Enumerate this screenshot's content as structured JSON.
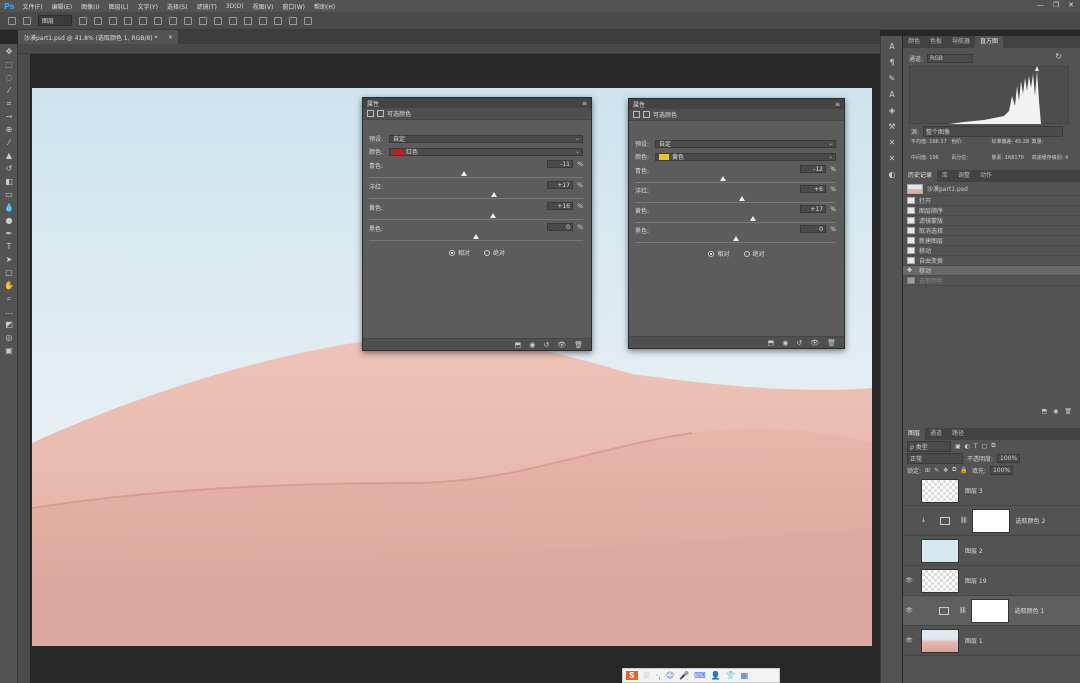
{
  "menubar": {
    "logo": "Ps",
    "items": [
      "文件(F)",
      "编辑(E)",
      "图像(I)",
      "图层(L)",
      "文字(Y)",
      "选择(S)",
      "滤镜(T)",
      "3D(D)",
      "视图(V)",
      "窗口(W)",
      "帮助(H)"
    ],
    "window_controls": [
      "—",
      "❐",
      "✕"
    ]
  },
  "optionsbar": {
    "auto_select_value": "图层"
  },
  "document": {
    "tab_title": "沙漠part1.psd @ 41.8% (选取颜色 1, RGB/8) *",
    "tab_close": "×"
  },
  "props_left": {
    "title": "属性",
    "header": "可选颜色",
    "preset_label": "预设:",
    "preset_value": "自定",
    "colors_label": "颜色:",
    "colors_value": "红色",
    "colors_swatch": "#d01818",
    "sliders": [
      {
        "name": "青色:",
        "value": "-11",
        "pct": "%",
        "level": 0.445
      },
      {
        "name": "洋红:",
        "value": "+17",
        "pct": "%",
        "level": 0.585
      },
      {
        "name": "黄色:",
        "value": "+16",
        "pct": "%",
        "level": 0.58
      },
      {
        "name": "黑色:",
        "value": "0",
        "pct": "%",
        "level": 0.5
      }
    ],
    "radio_relative": "相对",
    "radio_absolute": "绝对"
  },
  "props_right": {
    "title": "属性",
    "header": "可选颜色",
    "preset_label": "预设:",
    "preset_value": "自定",
    "colors_label": "颜色:",
    "colors_value": "黄色",
    "colors_swatch": "#e8c818",
    "sliders": [
      {
        "name": "青色:",
        "value": "-12",
        "pct": "%",
        "level": 0.44
      },
      {
        "name": "洋红:",
        "value": "+6",
        "pct": "%",
        "level": 0.53
      },
      {
        "name": "黄色:",
        "value": "+17",
        "pct": "%",
        "level": 0.585
      },
      {
        "name": "黑色:",
        "value": "0",
        "pct": "%",
        "level": 0.5
      }
    ],
    "radio_relative": "相对",
    "radio_absolute": "绝对"
  },
  "histogram_panel": {
    "tabs": [
      "颜色",
      "色板",
      "导航器",
      "直方图"
    ],
    "active_tab": "直方图",
    "channel_label": "通道:",
    "channel_value": "RGB",
    "source_label": "源:",
    "source_value": "整个图像",
    "stats": [
      "平均值: 186.37",
      "色阶:",
      "标准偏差: 45.28",
      "数量:",
      "中间值: 196",
      "百分位:",
      "像素: 168170",
      "高速缓存级别: 4"
    ]
  },
  "history_panel": {
    "tabs": [
      "历史记录",
      "库",
      "调整",
      "动作"
    ],
    "snapshot": "沙漠part1.psd",
    "items": [
      "打开",
      "图层顺序",
      "滤镜蒙版",
      "取消选择",
      "新建图层",
      "移动",
      "自由变换",
      "移动",
      "选取颜色"
    ],
    "selected_index": 7,
    "dim_index": 8
  },
  "layers_panel": {
    "tabs": [
      "图层",
      "通道",
      "路径"
    ],
    "kind_label": "ρ 类型",
    "blend_mode": "正常",
    "opacity_label": "不透明度:",
    "opacity_value": "100%",
    "lock_label": "锁定:",
    "fill_label": "填充:",
    "fill_value": "100%",
    "layers": [
      {
        "name": "图层 3",
        "thumb": "check",
        "visible": false
      },
      {
        "name": "选取颜色 2",
        "thumb": "adj",
        "visible": false
      },
      {
        "name": "图层 2",
        "thumb": "blue",
        "visible": false
      },
      {
        "name": "图层 19",
        "thumb": "check",
        "visible": true
      },
      {
        "name": "选取颜色 1",
        "thumb": "adj",
        "visible": true
      },
      {
        "name": "图层 1",
        "thumb": "pink",
        "visible": true
      }
    ]
  },
  "ime_bar": {
    "logo": "S",
    "lang": "英"
  }
}
